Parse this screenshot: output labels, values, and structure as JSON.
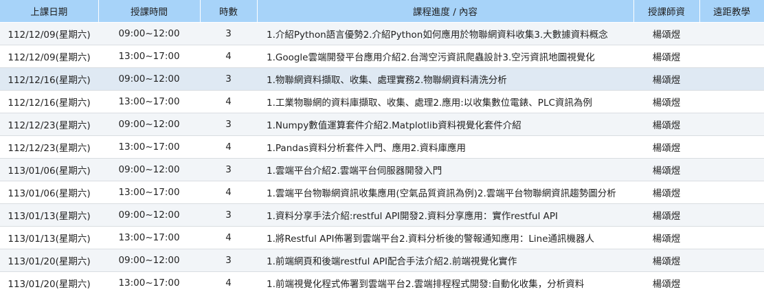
{
  "table": {
    "headers": [
      "上課日期",
      "授課時間",
      "時數",
      "課程進度 / 內容",
      "授課師資",
      "遠距教學"
    ],
    "rows": [
      {
        "date": "112/12/09(星期六)",
        "time": "09:00~12:00",
        "hours": "3",
        "content": "1.介紹Python語言優勢2.介紹Python如何應用於物聯網資料收集3.大數據資料概念",
        "teacher": "楊頌煜",
        "remote": ""
      },
      {
        "date": "112/12/09(星期六)",
        "time": "13:00~17:00",
        "hours": "4",
        "content": "1.Google雲端開發平台應用介紹2.台灣空污資訊爬蟲設計3.空污資訊地圖視覺化",
        "teacher": "楊頌煜",
        "remote": ""
      },
      {
        "date": "112/12/16(星期六)",
        "time": "09:00~12:00",
        "hours": "3",
        "content": "1.物聯網資料擷取、收集、處理實務2.物聯網資料清洗分析",
        "teacher": "楊頌煜",
        "remote": ""
      },
      {
        "date": "112/12/16(星期六)",
        "time": "13:00~17:00",
        "hours": "4",
        "content": "1.工業物聯網的資料庫擷取、收集、處理2.應用:以收集數位電錶、PLC資訊為例",
        "teacher": "楊頌煜",
        "remote": ""
      },
      {
        "date": "112/12/23(星期六)",
        "time": "09:00~12:00",
        "hours": "3",
        "content": "1.Numpy數值運算套件介紹2.Matplotlib資料視覺化套件介紹",
        "teacher": "楊頌煜",
        "remote": ""
      },
      {
        "date": "112/12/23(星期六)",
        "time": "13:00~17:00",
        "hours": "4",
        "content": "1.Pandas資料分析套件入門、應用2.資料庫應用",
        "teacher": "楊頌煜",
        "remote": ""
      },
      {
        "date": "113/01/06(星期六)",
        "time": "09:00~12:00",
        "hours": "3",
        "content": "1.雲端平台介紹2.雲端平台伺服器開發入門",
        "teacher": "楊頌煜",
        "remote": ""
      },
      {
        "date": "113/01/06(星期六)",
        "time": "13:00~17:00",
        "hours": "4",
        "content": "1.雲端平台物聯網資訊收集應用(空氣品質資訊為例)2.雲端平台物聯網資訊趨勢圖分析",
        "teacher": "楊頌煜",
        "remote": ""
      },
      {
        "date": "113/01/13(星期六)",
        "time": "09:00~12:00",
        "hours": "3",
        "content": "1.資料分享手法介紹:restful API開發2.資料分享應用：實作restful API",
        "teacher": "楊頌煜",
        "remote": ""
      },
      {
        "date": "113/01/13(星期六)",
        "time": "13:00~17:00",
        "hours": "4",
        "content": "1.將Restful API佈署到雲端平台2.資料分析後的警報通知應用：Line通訊機器人",
        "teacher": "楊頌煜",
        "remote": ""
      },
      {
        "date": "113/01/20(星期六)",
        "time": "09:00~12:00",
        "hours": "3",
        "content": "1.前端網頁和後端restful API配合手法介紹2.前端視覺化實作",
        "teacher": "楊頌煜",
        "remote": ""
      },
      {
        "date": "113/01/20(星期六)",
        "time": "13:00~17:00",
        "hours": "4",
        "content": "1.前端視覺化程式佈署到雲端平台2.雲端排程程式開發:自動化收集，分析資料",
        "teacher": "楊頌煜",
        "remote": ""
      }
    ]
  }
}
